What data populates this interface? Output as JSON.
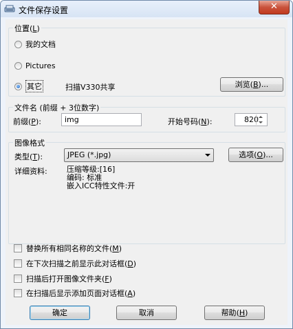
{
  "window": {
    "title": "文件保存设置",
    "close_label": "✕"
  },
  "location": {
    "legend": "位置",
    "legend_key": "L",
    "options": [
      {
        "label": "我的文档",
        "checked": false
      },
      {
        "label": "Pictures",
        "checked": false
      },
      {
        "label": "其它",
        "checked": true
      }
    ],
    "other_path": "扫描V330共享",
    "browse_label": "浏览",
    "browse_key": "B",
    "ellipsis": "..."
  },
  "filename": {
    "legend": "文件名 (前缀 + 3位数字)",
    "prefix_label": "前缀",
    "prefix_key": "P",
    "prefix_value": "img",
    "start_label": "开始号码",
    "start_key": "N",
    "start_value": "820"
  },
  "format": {
    "legend": "图像格式",
    "type_label": "类型",
    "type_key": "T",
    "type_value": "JPEG (*.jpg)",
    "options_label": "选项",
    "options_key": "O",
    "ellipsis": "...",
    "details_label": "详细资料:",
    "details": [
      "压缩等级:[16]",
      "编码: 标准",
      "嵌入ICC特性文件:开"
    ]
  },
  "checkboxes": [
    {
      "label": "替换所有相同名称的文件",
      "key": "M",
      "checked": false
    },
    {
      "label": "在下次扫描之前显示此对话框",
      "key": "D",
      "checked": false
    },
    {
      "label": "扫描后打开图像文件夹",
      "key": "F",
      "checked": false
    },
    {
      "label": "在扫描后显示添加页面对话框",
      "key": "A",
      "checked": false
    }
  ],
  "buttons": {
    "ok": "确定",
    "cancel": "取消",
    "help": "帮助",
    "help_key": "H"
  },
  "colors": {
    "title_bar": "#dbe6f4",
    "client": "#f0f0f0",
    "close": "#c9533c",
    "focus_border": "#3c7fb1"
  }
}
